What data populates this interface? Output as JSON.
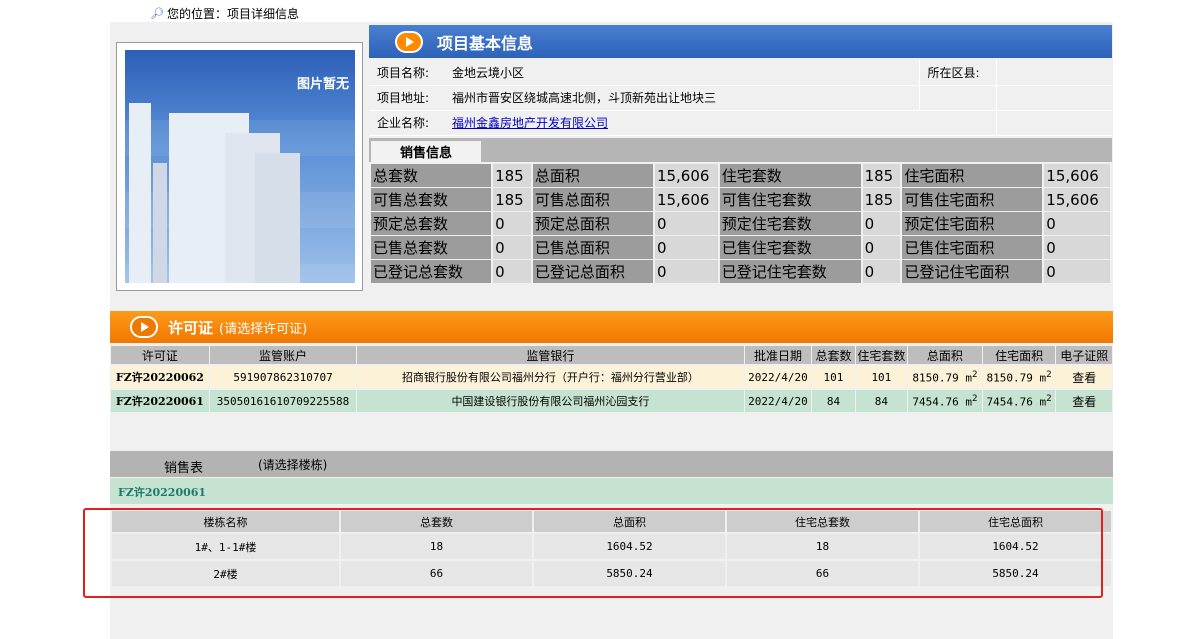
{
  "breadcrumb": {
    "label": "您的位置：项目详细信息"
  },
  "photo": {
    "placeholder_text": "图片暂无"
  },
  "basic_info": {
    "header": "项目基本信息",
    "project_name_label": "项目名称:",
    "project_name": "金地云境小区",
    "district_label": "所在区县:",
    "district": "",
    "address_label": "项目地址:",
    "address": "福州市晋安区绕城高速北侧，斗顶新苑出让地块三",
    "company_label": "企业名称:",
    "company": "福州金鑫房地产开发有限公司"
  },
  "sales_info": {
    "tab": "销售信息",
    "rows": [
      [
        "总套数",
        "185",
        "总面积",
        "15,606",
        "住宅套数",
        "185",
        "住宅面积",
        "15,606"
      ],
      [
        "可售总套数",
        "185",
        "可售总面积",
        "15,606",
        "可售住宅套数",
        "185",
        "可售住宅面积",
        "15,606"
      ],
      [
        "预定总套数",
        "0",
        "预定总面积",
        "0",
        "预定住宅套数",
        "0",
        "预定住宅面积",
        "0"
      ],
      [
        "已售总套数",
        "0",
        "已售总面积",
        "0",
        "已售住宅套数",
        "0",
        "已售住宅面积",
        "0"
      ],
      [
        "已登记总套数",
        "0",
        "已登记总面积",
        "0",
        "已登记住宅套数",
        "0",
        "已登记住宅面积",
        "0"
      ]
    ]
  },
  "permits": {
    "header": "许可证",
    "subheader": "(请选择许可证)",
    "columns": [
      "许可证",
      "监管账户",
      "监管银行",
      "批准日期",
      "总套数",
      "住宅套数",
      "总面积",
      "住宅面积",
      "电子证照"
    ],
    "rows": [
      {
        "permit": "FZ许20220062",
        "account": "591907862310707",
        "bank": "招商银行股份有限公司福州分行（开户行：福州分行营业部）",
        "date": "2022/4/20",
        "total_units": "101",
        "res_units": "101",
        "total_area": "8150.79 m",
        "res_area": "8150.79 m",
        "sup": "2",
        "view": "查看"
      },
      {
        "permit": "FZ许20220061",
        "account": "35050161610709225588",
        "bank": "中国建设银行股份有限公司福州沁园支行",
        "date": "2022/4/20",
        "total_units": "84",
        "res_units": "84",
        "total_area": "7454.76 m",
        "res_area": "7454.76 m",
        "sup": "2",
        "view": "查看"
      }
    ]
  },
  "sales_table": {
    "title": "销售表",
    "subtitle": "(请选择楼栋)",
    "selected_permit": "FZ许20220061",
    "columns": [
      "楼栋名称",
      "总套数",
      "总面积",
      "住宅总套数",
      "住宅总面积"
    ],
    "rows": [
      [
        "1#、1-1#楼",
        "18",
        "1604.52",
        "18",
        "1604.52"
      ],
      [
        "2#楼",
        "66",
        "5850.24",
        "66",
        "5850.24"
      ]
    ]
  },
  "colors": {
    "blue_header": "#2c62b8",
    "orange_header": "#f07800",
    "highlight": "#e0201c"
  }
}
